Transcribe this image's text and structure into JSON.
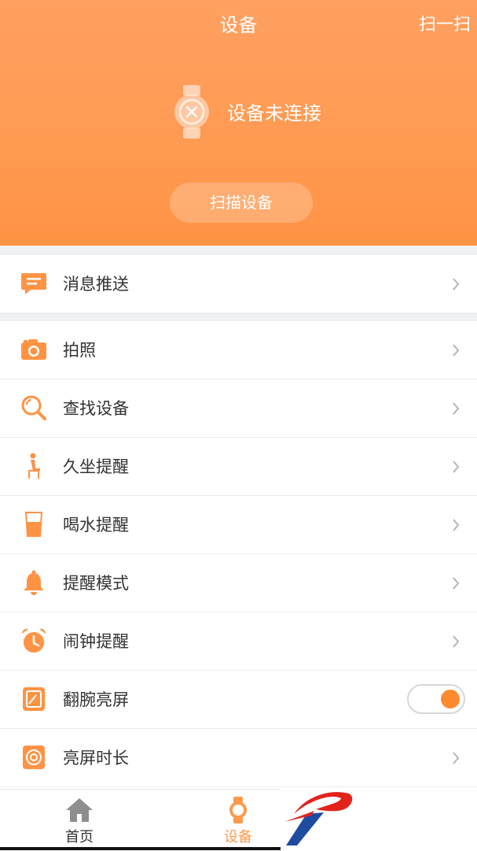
{
  "header": {
    "title": "设备",
    "scan_link": "扫一扫",
    "status": "设备未连接",
    "scan_button": "扫描设备"
  },
  "rows": [
    {
      "label": "消息推送",
      "icon": "message-icon",
      "control": "chevron"
    },
    {
      "label": "拍照",
      "icon": "camera-icon",
      "control": "chevron"
    },
    {
      "label": "查找设备",
      "icon": "search-icon",
      "control": "chevron"
    },
    {
      "label": "久坐提醒",
      "icon": "sitting-person-icon",
      "control": "chevron"
    },
    {
      "label": "喝水提醒",
      "icon": "water-cup-icon",
      "control": "chevron"
    },
    {
      "label": "提醒模式",
      "icon": "bell-icon",
      "control": "chevron"
    },
    {
      "label": "闹钟提醒",
      "icon": "alarm-clock-icon",
      "control": "chevron"
    },
    {
      "label": "翻腕亮屏",
      "icon": "wrist-screen-icon",
      "control": "toggle",
      "toggle_on": true
    },
    {
      "label": "亮屏时长",
      "icon": "screen-duration-icon",
      "control": "chevron"
    }
  ],
  "tabbar": {
    "tabs": [
      {
        "label": "首页",
        "icon": "home-icon",
        "active": false
      },
      {
        "label": "设备",
        "icon": "watch-icon",
        "active": true
      }
    ]
  },
  "colors": {
    "accent": "#ff9344",
    "header_top": "#ffa060",
    "tab_active": "#ff9a4a",
    "tab_inactive": "#8e8e8e",
    "list_gap": "#eff1f4"
  }
}
